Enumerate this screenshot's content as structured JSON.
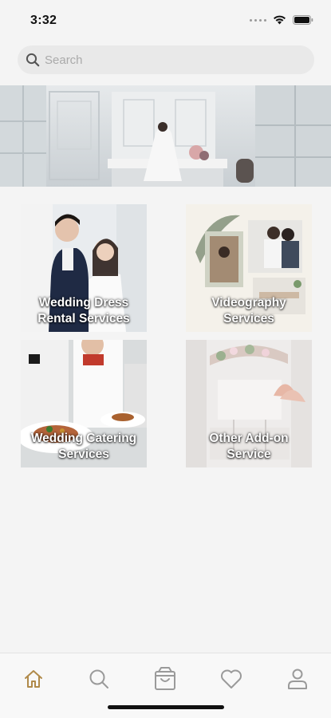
{
  "status_bar": {
    "time": "3:32"
  },
  "search": {
    "placeholder": "Search"
  },
  "categories": [
    {
      "label_line1": "Wedding Dress",
      "label_line2": "Rental Services"
    },
    {
      "label_line1": "Videography",
      "label_line2": "Services"
    },
    {
      "label_line1": "Wedding Catering",
      "label_line2": "Services"
    },
    {
      "label_line1": "Other Add-on",
      "label_line2": "Service"
    }
  ],
  "bottom_nav": {
    "items": [
      {
        "icon": "home-icon",
        "active": true
      },
      {
        "icon": "search-icon",
        "active": false
      },
      {
        "icon": "cart-icon",
        "active": false
      },
      {
        "icon": "heart-icon",
        "active": false
      },
      {
        "icon": "profile-icon",
        "active": false
      }
    ]
  },
  "colors": {
    "accent": "#b08a4a",
    "inactive": "#9a9a9a",
    "background": "#f4f4f4"
  }
}
